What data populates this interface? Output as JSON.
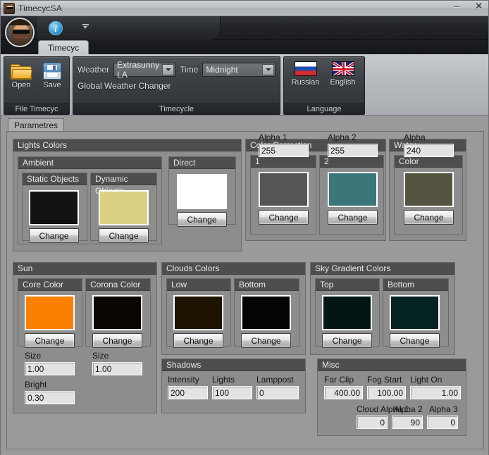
{
  "window": {
    "title": "TimecycSA",
    "minimize": "–",
    "close": "✕"
  },
  "quick_access": {
    "info_label": "i"
  },
  "ribbon": {
    "tab_label": "Timecyc",
    "groups": {
      "file": {
        "caption": "File Timecyc",
        "open_label": "Open",
        "save_label": "Save"
      },
      "timecycle": {
        "caption": "Timecycle",
        "weather_label": "Weather",
        "weather_value": "Extrasunny LA",
        "time_label": "Time",
        "time_value": "Midnight",
        "global_weather_changer": "Global Weather Changer"
      },
      "language": {
        "caption": "Language",
        "russian_label": "Russian",
        "english_label": "English"
      }
    }
  },
  "parameters_tab": {
    "label": "Parametres"
  },
  "change_label": "Change",
  "groups": {
    "lights_colors": {
      "caption": "Lights Colors",
      "ambient": {
        "caption": "Ambient",
        "static_objects": {
          "caption": "Static Objects",
          "color": "#121212"
        },
        "dynamic_objects": {
          "caption": "Dynamic Objects",
          "color": "#dbd183"
        }
      },
      "direct": {
        "caption": "Direct",
        "color": "#ffffff"
      }
    },
    "color_correction": {
      "caption": "Color Correction",
      "one": {
        "caption": "1",
        "color": "#555555",
        "alpha_label": "Alpha 1",
        "alpha_value": "255"
      },
      "two": {
        "caption": "2",
        "color": "#3b7679",
        "alpha_label": "Alpha 2",
        "alpha_value": "255"
      }
    },
    "water": {
      "caption": "Water",
      "color_caption": "Color",
      "color": "#555440",
      "alpha_label": "Alpha",
      "alpha_value": "240"
    },
    "sun": {
      "caption": "Sun",
      "core": {
        "caption": "Core Color",
        "color": "#fa8000",
        "size_label": "Size",
        "size_value": "1.00",
        "bright_label": "Bright",
        "bright_value": "0.30"
      },
      "corona": {
        "caption": "Corona Color",
        "color": "#0a0603",
        "size_label": "Size",
        "size_value": "1.00"
      }
    },
    "clouds_colors": {
      "caption": "Clouds Colors",
      "low": {
        "caption": "Low",
        "color": "#1e1201"
      },
      "bottom": {
        "caption": "Bottom",
        "color": "#050403"
      }
    },
    "shadows": {
      "caption": "Shadows",
      "intensity_label": "Intensity",
      "intensity_value": "200",
      "lights_label": "Lights",
      "lights_value": "100",
      "lamppost_label": "Lamppost",
      "lamppost_value": "0"
    },
    "sky_gradient_colors": {
      "caption": "Sky Gradient Colors",
      "top": {
        "caption": "Top",
        "color": "#031614"
      },
      "bottom": {
        "caption": "Bottom",
        "color": "#042220"
      }
    },
    "misc": {
      "caption": "Misc",
      "far_clip_label": "Far Clip",
      "far_clip_value": "400.00",
      "fog_start_label": "Fog Start",
      "fog_start_value": "100.00",
      "light_on_ground_label": "Light On Ground",
      "light_on_ground_value": "1.00",
      "cloud_alpha1_label": "Cloud Alpha 1",
      "cloud_alpha1_value": "0",
      "alpha2_label": "Alpha 2",
      "alpha2_value": "90",
      "alpha3_label": "Alpha 3",
      "alpha3_value": "0"
    }
  }
}
